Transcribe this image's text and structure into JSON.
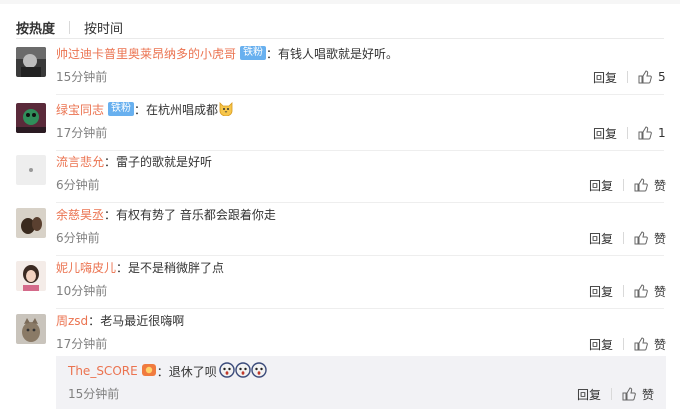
{
  "tabs": {
    "hot": "按热度",
    "time": "按时间"
  },
  "comments": [
    {
      "user": "帅过迪卡普里奥莱昂纳多的小虎哥",
      "badge": "铁粉",
      "text": "有钱人唱歌就是好听。",
      "time": "15分钟前",
      "reply": "回复",
      "likes": "5"
    },
    {
      "user": "绿宝同志",
      "badge": "铁粉",
      "text": "在杭州唱成都",
      "time": "17分钟前",
      "reply": "回复",
      "likes": "1",
      "emoji": "cat-face-icon"
    },
    {
      "user": "流言悲允",
      "text": "雷子的歌就是好听",
      "time": "6分钟前",
      "reply": "回复",
      "likes": "赞"
    },
    {
      "user": "余慈昊丞",
      "text": "有权有势了 音乐都会跟着你走",
      "time": "6分钟前",
      "reply": "回复",
      "likes": "赞"
    },
    {
      "user": "妮儿嗨皮儿",
      "text": "是不是稍微胖了点",
      "time": "10分钟前",
      "reply": "回复",
      "likes": "赞"
    },
    {
      "user": "周zsd",
      "text": "老马最近很嗨啊",
      "time": "17分钟前",
      "reply": "回复",
      "likes": "赞"
    }
  ],
  "subreply": {
    "user": "The_SCORE",
    "badge_icon": "fan-badge-icon",
    "text": "退休了呗",
    "emoji": "surprised-face-icon",
    "time": "15分钟前",
    "reply": "回复",
    "likes": "赞"
  },
  "colors": {
    "username": "#eb7350",
    "badge": "#68b0ef",
    "muted": "#808080",
    "subreply_bg": "#f2f2f5"
  }
}
